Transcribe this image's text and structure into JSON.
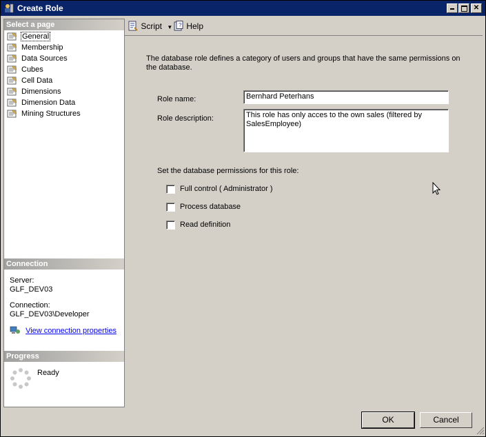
{
  "window": {
    "title": "Create Role"
  },
  "left": {
    "select_page_header": "Select a page",
    "pages": [
      {
        "label": "General"
      },
      {
        "label": "Membership"
      },
      {
        "label": "Data Sources"
      },
      {
        "label": "Cubes"
      },
      {
        "label": "Cell Data"
      },
      {
        "label": "Dimensions"
      },
      {
        "label": "Dimension Data"
      },
      {
        "label": "Mining Structures"
      }
    ],
    "selected_page": "General",
    "connection_header": "Connection",
    "server_label": "Server:",
    "server_value": "GLF_DEV03",
    "connection_label": "Connection:",
    "connection_value": "GLF_DEV03\\Developer",
    "view_connection_link": "View connection properties",
    "progress_header": "Progress",
    "progress_status": "Ready"
  },
  "toolbar": {
    "script_label": "Script",
    "help_label": "Help"
  },
  "general": {
    "description": "The database role defines a category of users and groups that have the same permissions on the database.",
    "role_name_label": "Role name:",
    "role_name_value": "Bernhard Peterhans",
    "role_description_label": "Role description:",
    "role_description_value": "This role has only acces to the own sales (filtered by SalesEmployee)",
    "permissions_label": "Set the database permissions for this role:",
    "permissions": [
      {
        "label": "Full control ( Administrator )",
        "checked": false
      },
      {
        "label": "Process database",
        "checked": false
      },
      {
        "label": "Read definition",
        "checked": false
      }
    ]
  },
  "footer": {
    "ok_label": "OK",
    "cancel_label": "Cancel"
  }
}
